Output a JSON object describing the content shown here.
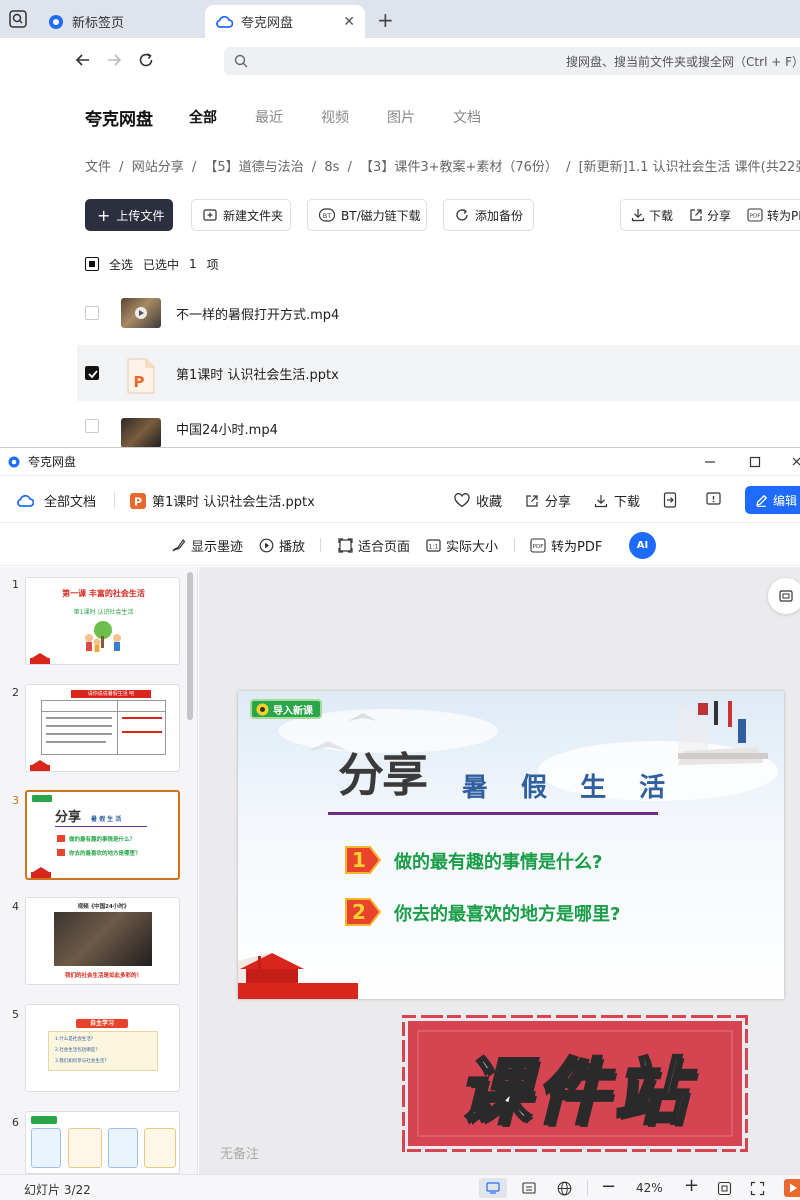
{
  "browser": {
    "tabs": [
      {
        "label": "新标签页"
      },
      {
        "label": "夸克网盘"
      }
    ],
    "address_placeholder": "搜网盘、搜当前文件夹或搜全网（Ctrl + F）"
  },
  "pan": {
    "logo": "夸克网盘",
    "nav_tabs": [
      "全部",
      "最近",
      "视频",
      "图片",
      "文档"
    ],
    "breadcrumb": [
      "文件",
      "/",
      "网站分享",
      "/",
      "【5】道德与法治",
      "/",
      "8s",
      "/",
      "【3】课件3+教案+素材（76份）",
      "/",
      "[新更新]1.1 认识社会生活 课件(共22张PPT)"
    ],
    "buttons": {
      "upload": "上传文件",
      "new_folder": "新建文件夹",
      "bt": "BT/磁力链下载",
      "backup": "添加备份",
      "download": "下载",
      "share": "分享",
      "to_pdf": "转为PDF"
    },
    "select": {
      "all": "全选",
      "selected": "已选中",
      "count": "1",
      "unit": "项"
    },
    "files": [
      {
        "name": "不一样的暑假打开方式.mp4",
        "checked": false
      },
      {
        "name": "第1课时  认识社会生活.pptx",
        "checked": true
      },
      {
        "name": "中国24小时.mp4",
        "checked": false
      }
    ]
  },
  "viewer": {
    "window_title": "夸克网盘",
    "all_docs": "全部文档",
    "file_name": "第1课时 认识社会生活.pptx",
    "actions": {
      "favorite": "收藏",
      "share": "分享",
      "download": "下载",
      "edit": "编辑"
    },
    "subtools": {
      "ink": "显示墨迹",
      "play": "播放",
      "fit": "适合页面",
      "actual": "实际大小",
      "pdf": "转为PDF",
      "ai": "AI"
    },
    "thumbs": [
      {
        "num": "1",
        "title": "第一课  丰富的社会生活",
        "sub": "第1课时  认识社会生活"
      },
      {
        "num": "2",
        "header": "请你说说暑假生活 吧"
      },
      {
        "num": "3",
        "title": "分享",
        "sub": "暑 假 生 活",
        "q1": "做的最有趣的事情是什么？",
        "q2": "你去的最喜欢的地方是哪里？"
      },
      {
        "num": "4",
        "title": "视频《中国24小时》",
        "caption": "我们的社会生活是如此多彩的！"
      },
      {
        "num": "5",
        "title": "自主学习",
        "lines": [
          "1.什么是社会生活？",
          "2.社会生活包括哪些？",
          "3.我们如何参与社会生活？"
        ]
      },
      {
        "num": "6"
      }
    ],
    "slide": {
      "badge": "导入新课",
      "title": "分享",
      "subtitle": "暑 假 生 活",
      "num1": "1",
      "q1": "做的最有趣的事情是什么?",
      "num2": "2",
      "q2": "你去的最喜欢的地方是哪里?"
    },
    "note": "无备注",
    "status": {
      "slide_counter": "幻灯片 3/22",
      "zoom": "42%"
    },
    "watermark": "课件站"
  }
}
